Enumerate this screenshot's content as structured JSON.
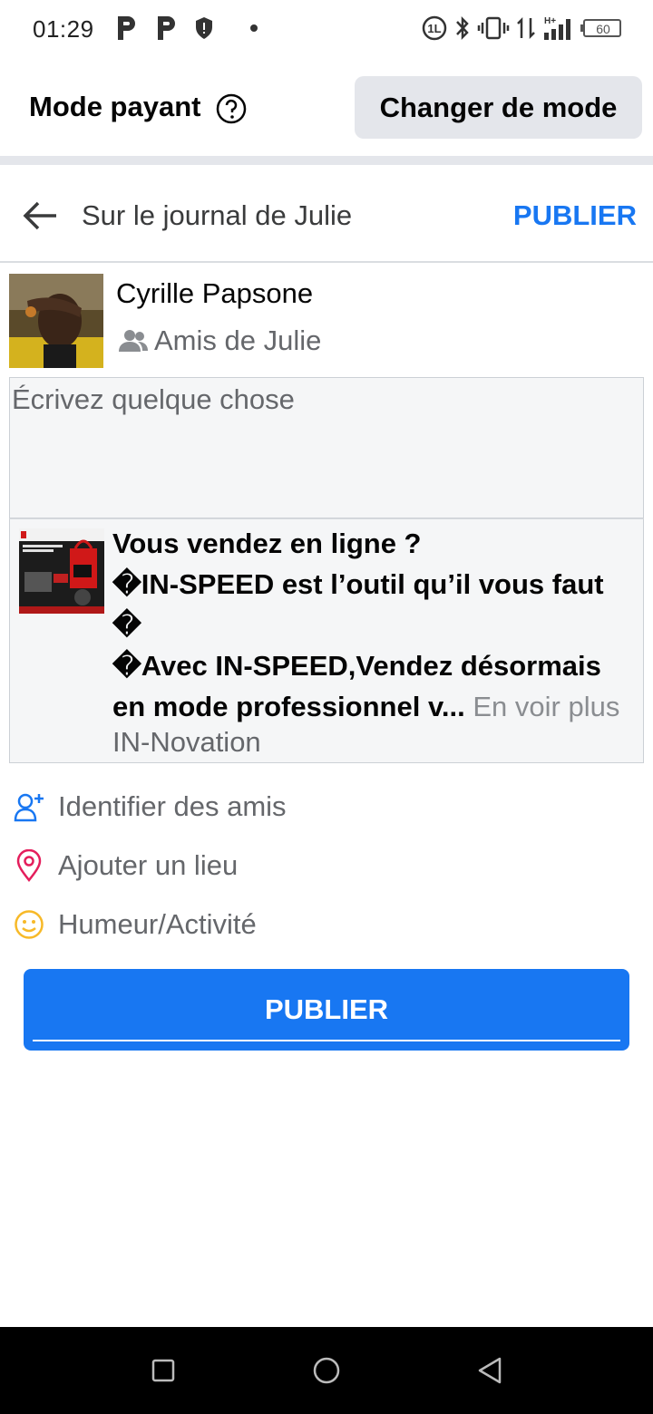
{
  "status_bar": {
    "time": "01:29",
    "network": "H+",
    "battery": "60"
  },
  "mode_bar": {
    "title": "Mode payant",
    "change_button": "Changer de mode"
  },
  "header": {
    "title": "Sur le journal de Julie",
    "publish_label": "PUBLIER"
  },
  "author": {
    "name": "Cyrille Papsone",
    "audience": "Amis de Julie"
  },
  "composer": {
    "placeholder": "Écrivez quelque chose"
  },
  "link_card": {
    "line1": "Vous vendez en ligne ?",
    "line2": "�IN-SPEED est l’outil qu’il vous faut",
    "line3": "�",
    "line4": "�Avec IN-SPEED,Vendez désormais",
    "line5": "en mode professionnel v...",
    "see_more": "En voir plus",
    "source": "IN-Novation"
  },
  "actions": [
    {
      "label": "Identifier des amis",
      "icon": "tag-friends-icon"
    },
    {
      "label": "Ajouter un lieu",
      "icon": "location-pin-icon"
    },
    {
      "label": "Humeur/Activité",
      "icon": "smiley-icon"
    }
  ],
  "publish_button": "PUBLIER",
  "colors": {
    "accent": "#1877f2",
    "secondary_text": "#65676b",
    "pin": "#e41e5c",
    "smiley": "#f7b928"
  }
}
